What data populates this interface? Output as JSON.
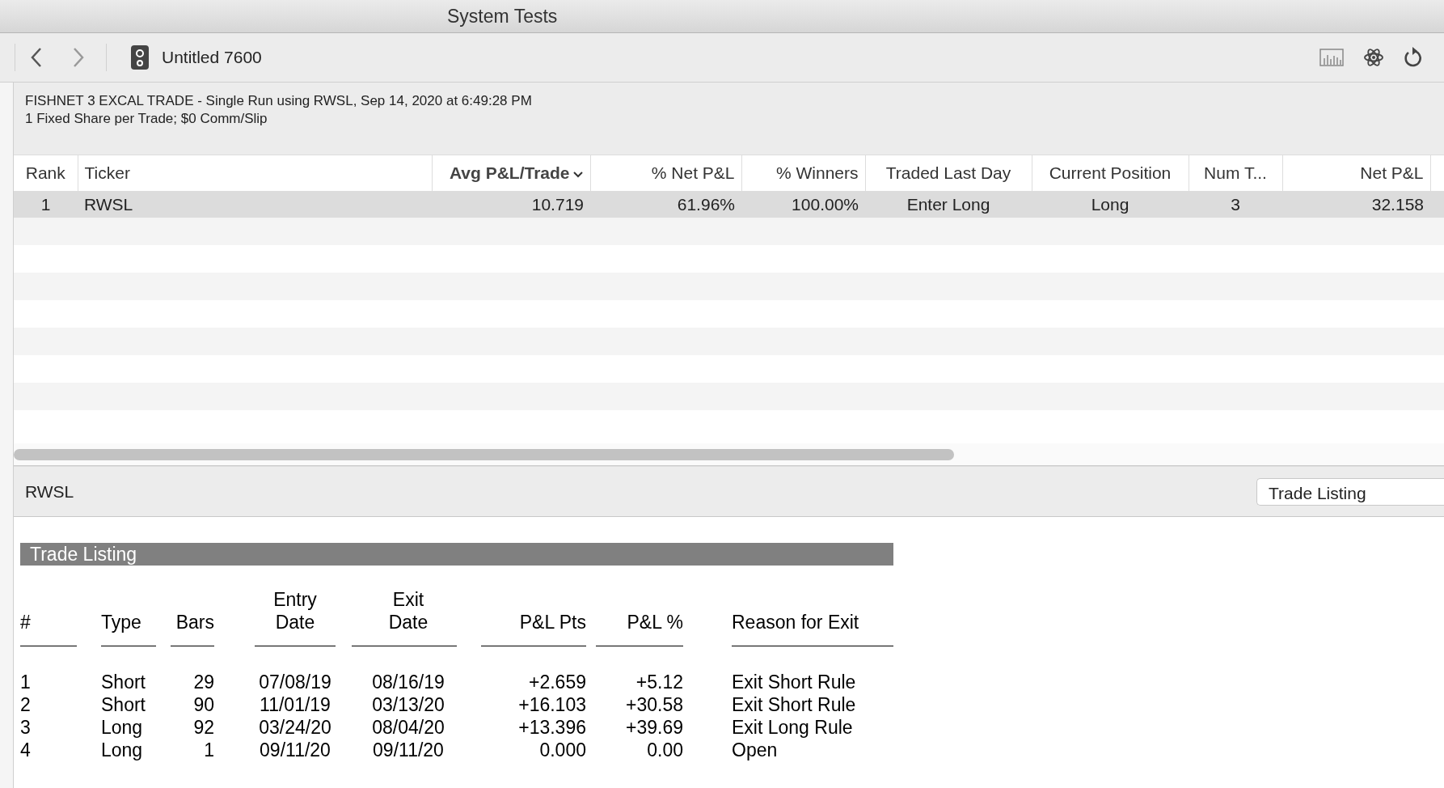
{
  "window": {
    "title": "System Tests"
  },
  "toolbar": {
    "document_title": "Untitled 7600"
  },
  "info": {
    "lines": [
      "FISHNET 3 EXCAL TRADE - Single Run using RWSL, Sep 14, 2020 at 6:49:28 PM",
      "1 Fixed Share per Trade; $0 Comm/Slip"
    ]
  },
  "table": {
    "columns": [
      {
        "label": "Rank",
        "sorted": false
      },
      {
        "label": "Ticker",
        "sorted": false
      },
      {
        "label": "Avg P&L/Trade",
        "sorted": true
      },
      {
        "label": "% Net P&L",
        "sorted": false
      },
      {
        "label": "% Winners",
        "sorted": false
      },
      {
        "label": "Traded Last Day",
        "sorted": false
      },
      {
        "label": "Current Position",
        "sorted": false
      },
      {
        "label": "Num T...",
        "sorted": false
      },
      {
        "label": "Net P&L",
        "sorted": false
      }
    ],
    "rows": [
      {
        "cells": [
          "1",
          "RWSL",
          "10.719",
          "61.96%",
          "100.00%",
          "Enter Long",
          "Long",
          "3",
          "32.158"
        ],
        "selected": true
      }
    ]
  },
  "detail": {
    "ticker": "RWSL",
    "view_select": "Trade Listing"
  },
  "report": {
    "title": "Trade Listing",
    "columns": [
      "#",
      "Type",
      "Bars",
      "Entry Date",
      "Exit Date",
      "P&L Pts",
      "P&L %",
      "Reason for Exit"
    ],
    "rows": [
      [
        "1",
        "Short",
        "29",
        "07/08/19",
        "08/16/19",
        "+2.659",
        "+5.12",
        "Exit Short Rule"
      ],
      [
        "2",
        "Short",
        "90",
        "11/01/19",
        "03/13/20",
        "+16.103",
        "+30.58",
        "Exit Short Rule"
      ],
      [
        "3",
        "Long",
        "92",
        "03/24/20",
        "08/04/20",
        "+13.396",
        "+39.69",
        "Exit Long Rule"
      ],
      [
        "4",
        "Long",
        "1",
        "09/11/20",
        "09/11/20",
        "0.000",
        "0.00",
        "Open"
      ]
    ]
  }
}
